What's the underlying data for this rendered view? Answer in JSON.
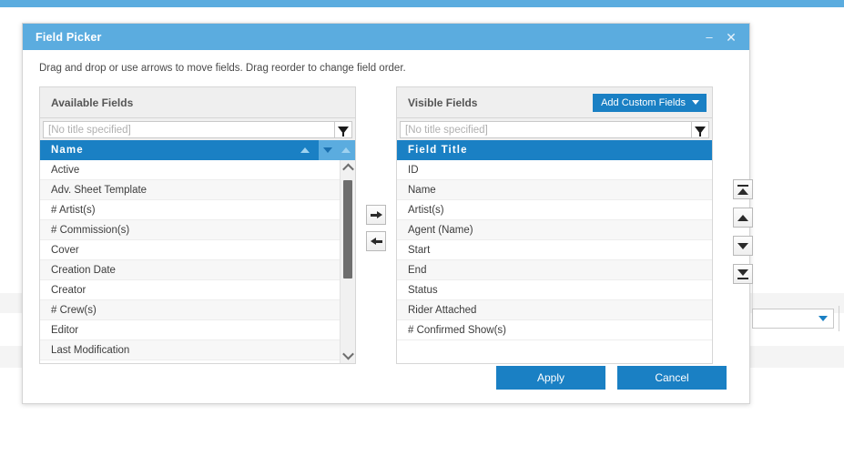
{
  "window": {
    "title": "Field Picker",
    "minimize_label": "–",
    "close_label": "✕"
  },
  "instructions": "Drag and drop or use arrows to move fields. Drag reorder to change field order.",
  "available_panel": {
    "header_title": "Available Fields",
    "filter_placeholder": "[No title specified]",
    "filter_value": "",
    "column_header": "Name",
    "items": [
      "Active",
      "Adv. Sheet Template",
      "# Artist(s)",
      "# Commission(s)",
      "Cover",
      "Creation Date",
      "Creator",
      "# Crew(s)",
      "Editor",
      "Last Modification"
    ]
  },
  "visible_panel": {
    "header_title": "Visible Fields",
    "add_custom_fields_label": "Add Custom Fields",
    "filter_placeholder": "[No title specified]",
    "filter_value": "",
    "column_header": "Field Title",
    "items": [
      "ID",
      "Name",
      "Artist(s)",
      "Agent (Name)",
      "Start",
      "End",
      "Status",
      "Rider Attached",
      "# Confirmed Show(s)"
    ]
  },
  "transfer_buttons": {
    "move_right_label": "→",
    "move_left_label": "←"
  },
  "reorder_buttons": {
    "move_to_top_label": "Move to top",
    "move_up_label": "Move up",
    "move_down_label": "Move down",
    "move_to_bottom_label": "Move to bottom"
  },
  "footer": {
    "apply_label": "Apply",
    "cancel_label": "Cancel"
  },
  "colors": {
    "titlebar_blue": "#5bacdf",
    "accent_blue": "#1a80c4",
    "panel_header_gray": "#efefef",
    "row_alt_gray": "#f7f7f7"
  }
}
